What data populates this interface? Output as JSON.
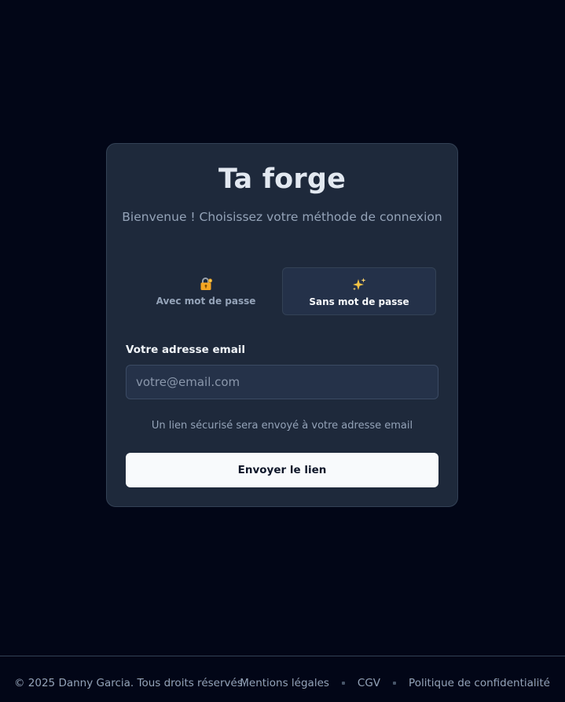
{
  "card": {
    "title": "Ta forge",
    "subtitle": "Bienvenue ! Choisissez votre méthode de connexion"
  },
  "methods": [
    {
      "label": "Avec mot de passe",
      "icon": "lock-key-icon",
      "selected": false
    },
    {
      "label": "Sans mot de passe",
      "icon": "sparkles-icon",
      "selected": true
    }
  ],
  "form": {
    "email_label": "Votre adresse email",
    "email_placeholder": "votre@email.com",
    "email_value": "",
    "hint": "Un lien sécurisé sera envoyé à votre adresse email",
    "submit_label": "Envoyer le lien"
  },
  "footer": {
    "copyright": "© 2025 Danny Garcia. Tous droits réservés.",
    "links": [
      "Mentions légales",
      "CGV",
      "Politique de confidentialité"
    ]
  },
  "colors": {
    "background": "#020617",
    "card": "#1e293b",
    "selected_tab": "#243149",
    "button": "#f8fafc",
    "muted_text": "#94a3b8"
  }
}
